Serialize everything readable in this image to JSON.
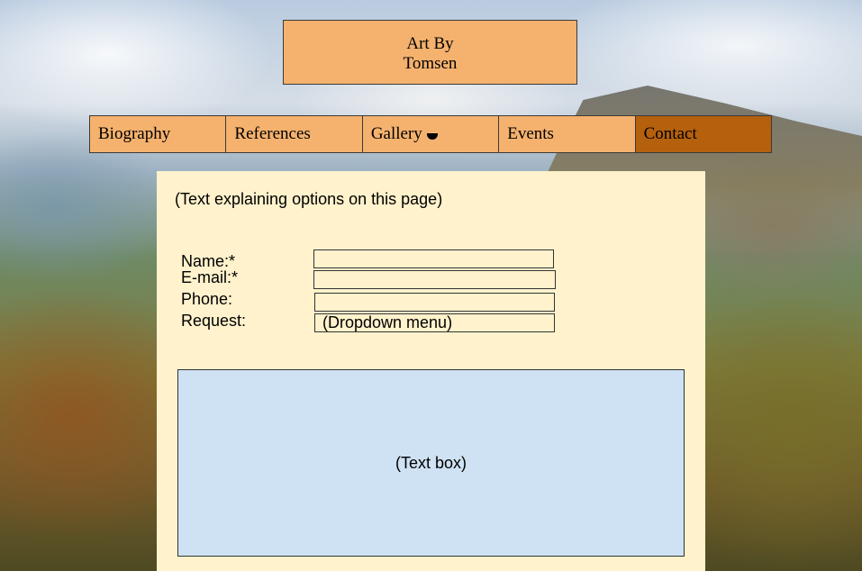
{
  "header": {
    "title_line1": "Art By",
    "title_line2": "Tomsen"
  },
  "nav": {
    "items": [
      {
        "label": "Biography"
      },
      {
        "label": "References"
      },
      {
        "label": "Gallery"
      },
      {
        "label": "Events"
      },
      {
        "label": "Contact"
      }
    ],
    "active": "Contact"
  },
  "main": {
    "intro_text": "(Text explaining options on this page)",
    "form": {
      "name_label": "Name:*",
      "email_label": "E-mail:*",
      "phone_label": "Phone:",
      "request_label": "Request:",
      "name_value": "",
      "email_value": "",
      "phone_value": "",
      "request_value": "(Dropdown menu)"
    },
    "textbox_text": "(Text box)"
  },
  "icons": {
    "gallery_dropdown": "chevron-down-icon"
  },
  "colors": {
    "nav_bg": "#f5b26e",
    "nav_active_bg": "#b5600d",
    "panel_bg": "#fff2cc",
    "textbox_bg": "#cfe2f3"
  }
}
